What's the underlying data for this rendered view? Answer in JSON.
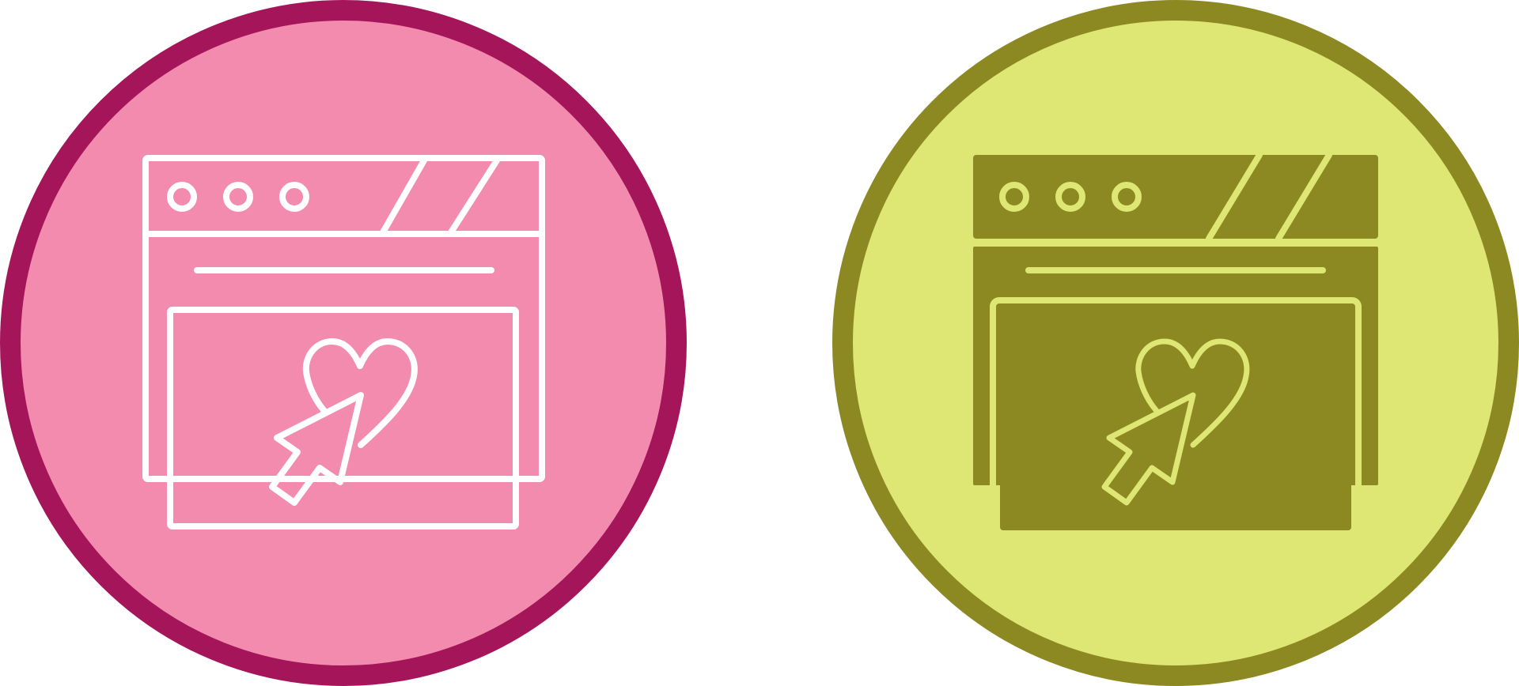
{
  "icons": [
    {
      "name": "website-favorite-click-icon",
      "style": "outline",
      "colors": {
        "ring": "#A4155A",
        "fill": "#F28BAE",
        "stroke": "#FFFFFF"
      }
    },
    {
      "name": "website-favorite-click-icon",
      "style": "glyph",
      "colors": {
        "ring": "#8C8923",
        "fill": "#DEE674",
        "shape": "#8C8923",
        "detail": "#DEE674"
      }
    }
  ]
}
